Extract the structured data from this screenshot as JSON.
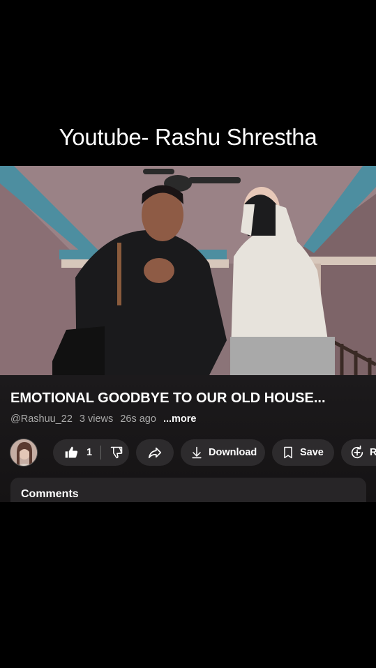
{
  "overlay": {
    "title": "Youtube- Rashu Shrestha"
  },
  "video": {
    "title": "EMOTIONAL GOODBYE TO OUR OLD HOUSE...",
    "channel": "@Rashuu_22",
    "views": "3 views",
    "age": "26s ago",
    "more_label": "...more"
  },
  "actions": {
    "like_count": "1",
    "download_label": "Download",
    "save_label": "Save",
    "remix_label": "Re"
  },
  "comments": {
    "label": "Comments"
  },
  "colors": {
    "background": "#000000",
    "panel": "#1c1a1c",
    "pill": "#2d2b2d",
    "meta_text": "#aaaaaa"
  },
  "icons": [
    "like-icon",
    "dislike-icon",
    "share-icon",
    "download-icon",
    "save-icon",
    "remix-icon"
  ]
}
